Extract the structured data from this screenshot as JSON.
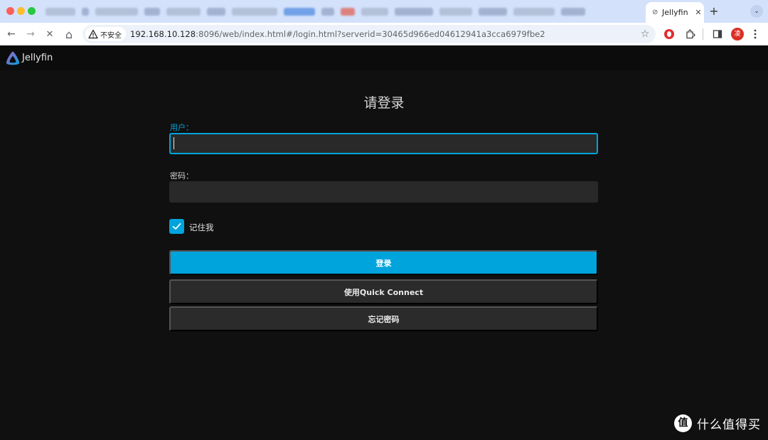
{
  "browser": {
    "tab": {
      "title": "Jellyfin",
      "favicon": "jellyfin-favicon",
      "close": "✕"
    },
    "new_tab": "+",
    "tab_menu": "⌄",
    "nav": {
      "back": "←",
      "forward": "→",
      "reload": "✕",
      "home": "⌂"
    },
    "address": {
      "security_label": "不安全",
      "url_host": "192.168.10.128",
      "url_rest": ":8096/web/index.html#/login.html?serverid=30465d966ed04612941a3cca6979fbe2"
    },
    "star": "☆",
    "avatar": "凌",
    "colors": {
      "tabstrip": "#d3e1fb",
      "omnibox": "#edf2fa"
    }
  },
  "app": {
    "name": "Jellyfin",
    "colors": {
      "accent": "#00a4dc",
      "background": "#101010",
      "input_bg": "#292929",
      "button_bg": "#2b2b2b"
    }
  },
  "login": {
    "title": "请登录",
    "username_label": "用户：",
    "username_value": "",
    "password_label": "密码：",
    "password_value": "",
    "remember_me_label": "记住我",
    "remember_me_checked": true,
    "login_button": "登录",
    "quick_connect_button": "使用Quick Connect",
    "forgot_password_button": "忘记密码"
  },
  "watermark": {
    "badge": "值",
    "text": "什么值得买"
  }
}
